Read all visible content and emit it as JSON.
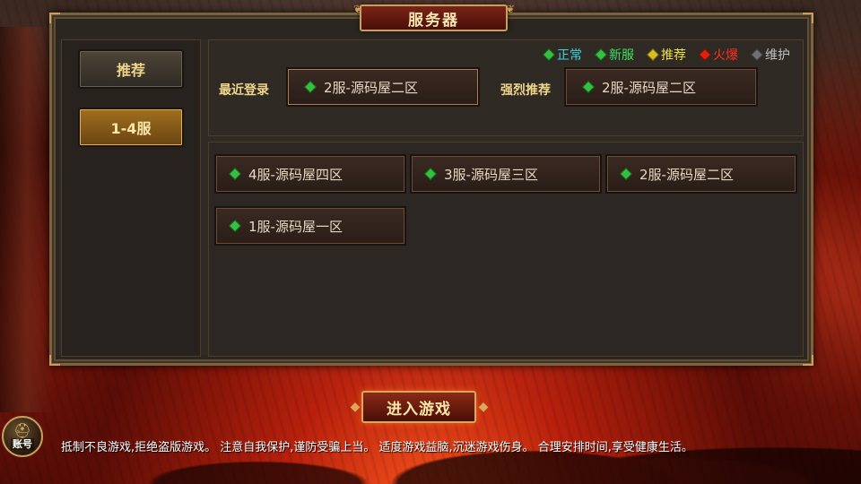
{
  "title": "服务器",
  "sidebar": {
    "items": [
      {
        "label": "推荐",
        "active": false
      },
      {
        "label": "1-4服",
        "active": true
      }
    ]
  },
  "legend": [
    {
      "label": "正常",
      "color": "#34c040",
      "text_color": "#3fd0e0",
      "icon": "green-gem-icon"
    },
    {
      "label": "新服",
      "color": "#34c040",
      "text_color": "#3fe060",
      "icon": "green-gem-icon"
    },
    {
      "label": "推荐",
      "color": "#d8c020",
      "text_color": "#f0e040",
      "icon": "yellow-gem-icon"
    },
    {
      "label": "火爆",
      "color": "#e02010",
      "text_color": "#ff3020",
      "icon": "red-gem-icon"
    },
    {
      "label": "维护",
      "color": "#707070",
      "text_color": "#c0c0c0",
      "icon": "gray-gem-icon"
    }
  ],
  "recent": {
    "label": "最近登录",
    "server": "2服-源码屋二区",
    "status_color": "#34c040"
  },
  "recommended": {
    "label": "强烈推荐",
    "server": "2服-源码屋二区",
    "status_color": "#34c040"
  },
  "servers": [
    {
      "name": "4服-源码屋四区",
      "status_color": "#34c040"
    },
    {
      "name": "3服-源码屋三区",
      "status_color": "#34c040"
    },
    {
      "name": "2服-源码屋二区",
      "status_color": "#34c040"
    },
    {
      "name": "1服-源码屋一区",
      "status_color": "#34c040"
    }
  ],
  "enter_button": "进入游戏",
  "account_button": "账号",
  "notice": "抵制不良游戏,拒绝盗版游戏。 注意自我保护,谨防受骗上当。 适度游戏益脑,沉迷游戏伤身。 合理安排时间,享受健康生活。"
}
